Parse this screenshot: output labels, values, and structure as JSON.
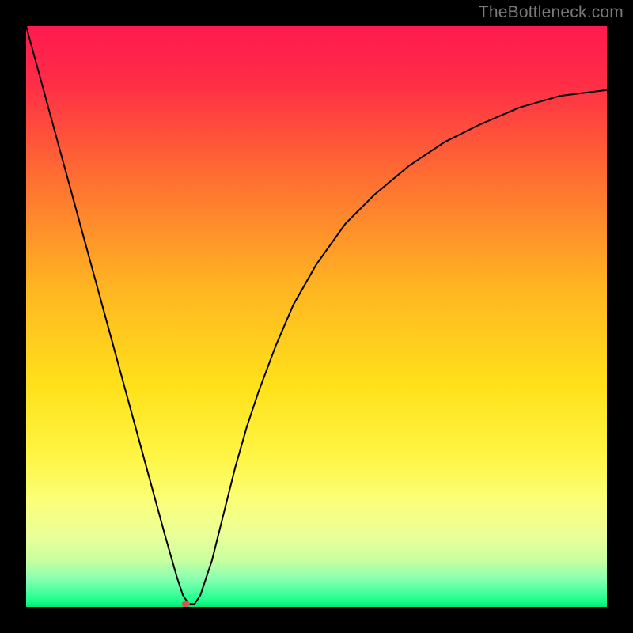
{
  "watermark": "TheBottleneck.com",
  "chart_data": {
    "type": "line",
    "title": "",
    "xlabel": "",
    "ylabel": "",
    "xlim": [
      0,
      100
    ],
    "ylim": [
      0,
      100
    ],
    "background_gradient": {
      "stops": [
        {
          "offset": 0.0,
          "color": "#ff1a4f"
        },
        {
          "offset": 0.1,
          "color": "#ff2e46"
        },
        {
          "offset": 0.25,
          "color": "#ff6a33"
        },
        {
          "offset": 0.45,
          "color": "#ffb522"
        },
        {
          "offset": 0.62,
          "color": "#ffe11a"
        },
        {
          "offset": 0.74,
          "color": "#fff544"
        },
        {
          "offset": 0.82,
          "color": "#fbff7a"
        },
        {
          "offset": 0.88,
          "color": "#e9ff9a"
        },
        {
          "offset": 0.92,
          "color": "#c8ff9f"
        },
        {
          "offset": 0.95,
          "color": "#8cffb0"
        },
        {
          "offset": 0.975,
          "color": "#47ff9e"
        },
        {
          "offset": 0.99,
          "color": "#19ff88"
        },
        {
          "offset": 1.0,
          "color": "#07e676"
        }
      ]
    },
    "series": [
      {
        "name": "curve",
        "color": "#000000",
        "width": 2,
        "x": [
          0,
          3,
          6,
          9,
          12,
          15,
          18,
          21,
          24,
          26,
          27,
          28,
          29,
          30,
          32,
          34,
          36,
          38,
          40,
          43,
          46,
          50,
          55,
          60,
          66,
          72,
          78,
          85,
          92,
          100
        ],
        "y": [
          100,
          89,
          78,
          67,
          56,
          45,
          34,
          23,
          12,
          5,
          2,
          0.5,
          0.5,
          2,
          8,
          16,
          24,
          31,
          37,
          45,
          52,
          59,
          66,
          71,
          76,
          80,
          83,
          86,
          88,
          89
        ]
      }
    ],
    "marker": {
      "x": 27.5,
      "y": 0.5,
      "rx": 5,
      "ry": 4,
      "fill": "#d9534f"
    }
  }
}
